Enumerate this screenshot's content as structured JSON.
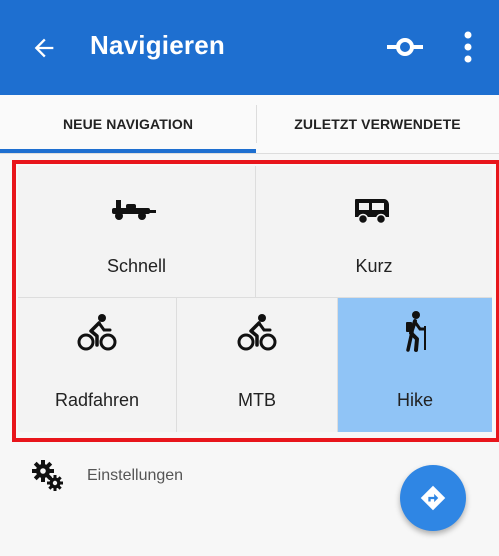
{
  "appbar": {
    "title": "Navigieren",
    "color": "#1e6fd0"
  },
  "tabs": [
    {
      "label": "NEUE NAVIGATION",
      "active": true
    },
    {
      "label": "ZULETZT VERWENDETE",
      "active": false
    }
  ],
  "profiles": [
    {
      "label": "Schnell",
      "icon": "race-car-icon",
      "selected": false
    },
    {
      "label": "Kurz",
      "icon": "van-icon",
      "selected": false
    },
    {
      "label": "Radfahren",
      "icon": "cyclist-icon",
      "selected": false
    },
    {
      "label": "MTB",
      "icon": "mountain-bike-icon",
      "selected": false
    },
    {
      "label": "Hike",
      "icon": "hiker-icon",
      "selected": true
    }
  ],
  "settings": {
    "label": "Einstellungen",
    "icon": "gears-icon"
  },
  "colors": {
    "highlight_border": "#e8151b",
    "selected_cell": "#90c4f6",
    "fab": "#2f86e4"
  }
}
